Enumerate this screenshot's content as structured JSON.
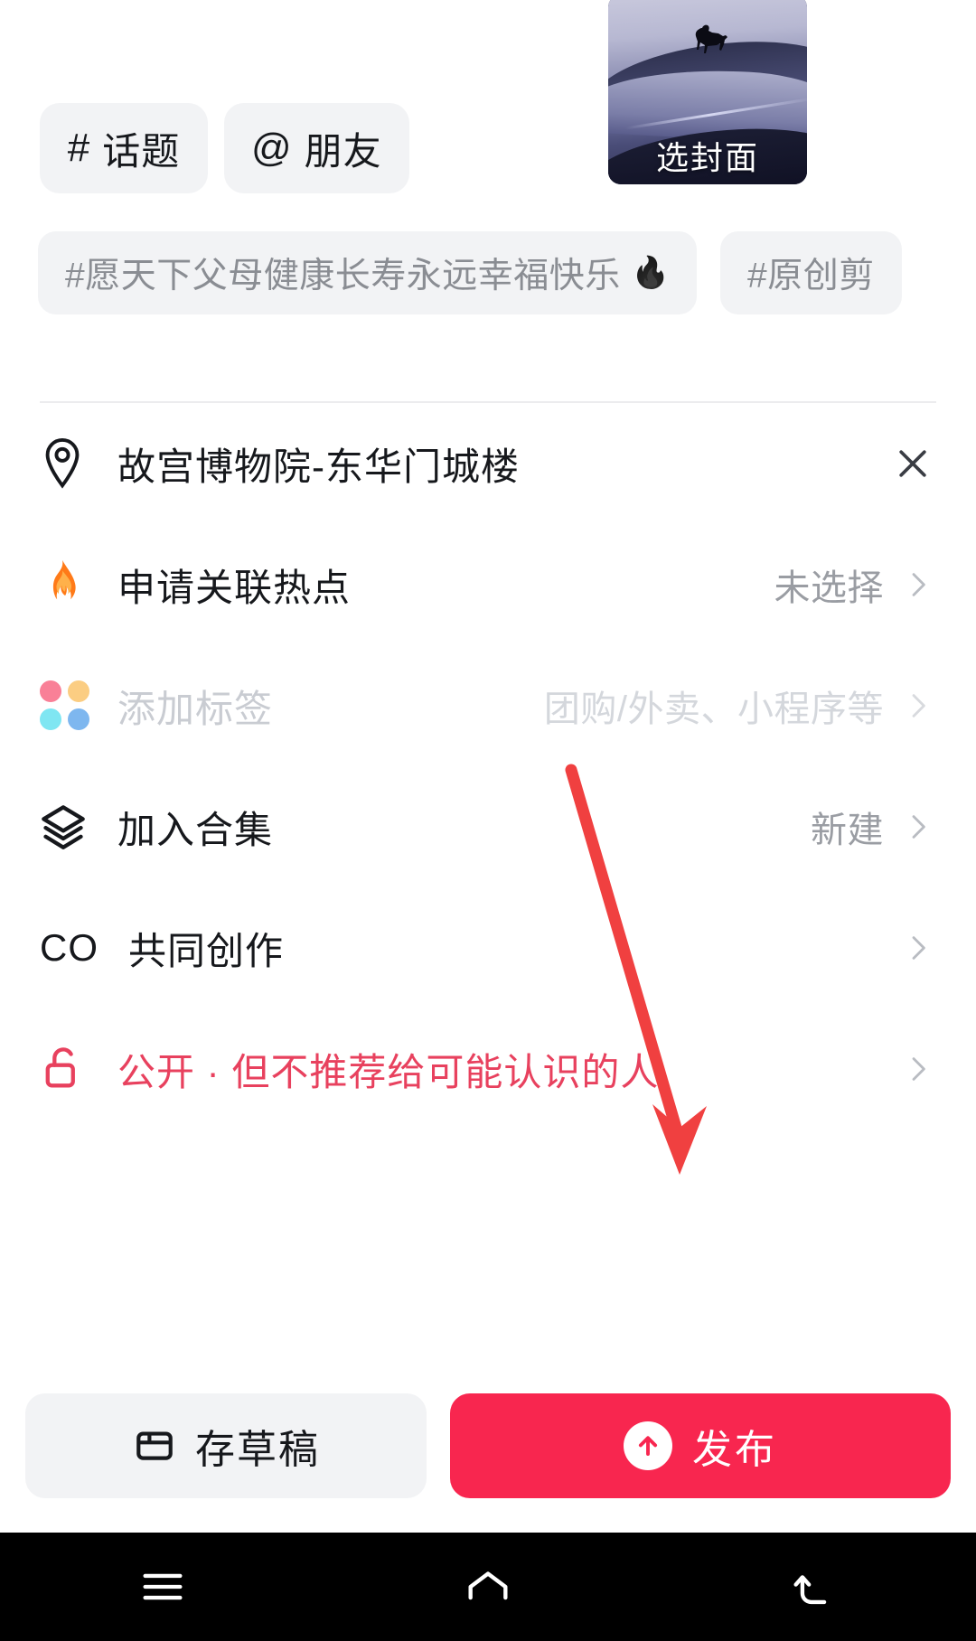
{
  "app": {
    "screen_title": "抖音发布页",
    "accent_color": "#f8264f",
    "privacy_color": "#e8415e",
    "chip_bg": "#f2f3f5"
  },
  "chips": [
    {
      "glyph": "#",
      "label": "话题",
      "icon": "hash-icon"
    },
    {
      "glyph": "@",
      "label": "朋友",
      "icon": "at-icon"
    }
  ],
  "cover": {
    "label": "选封面",
    "icon": "cover-thumbnail",
    "alt": "雪山骑马剪影封面图"
  },
  "tag_suggestions": [
    {
      "text": "#愿天下父母健康长寿永远幸福快乐",
      "fire": "🔥",
      "has_fire": true
    },
    {
      "text": "#原创剪",
      "fire": "",
      "has_fire": false
    }
  ],
  "rows": [
    {
      "key": "location",
      "icon": "location-pin-icon",
      "label": "故宫博物院-东华门城楼",
      "label_style": "normal",
      "value": "",
      "value_style": "normal",
      "trailing": "close",
      "trailing_icon": "close-icon"
    },
    {
      "key": "hotspot",
      "icon": "flame-icon",
      "label": "申请关联热点",
      "label_style": "normal",
      "value": "未选择",
      "value_style": "normal",
      "trailing": "chevron",
      "trailing_icon": "chevron-right-icon"
    },
    {
      "key": "add_tag",
      "icon": "four-dots-icon",
      "label": "添加标签",
      "label_style": "muted",
      "value": "团购/外卖、小程序等",
      "value_style": "faint",
      "trailing": "chevron",
      "trailing_icon": "chevron-right-icon"
    },
    {
      "key": "collection",
      "icon": "layers-icon",
      "label": "加入合集",
      "label_style": "normal",
      "value": "新建",
      "value_style": "normal",
      "trailing": "chevron",
      "trailing_icon": "chevron-right-icon"
    },
    {
      "key": "co_creation",
      "icon": "co-icon",
      "label": "共同创作",
      "label_style": "normal",
      "value": "",
      "value_style": "normal",
      "trailing": "chevron",
      "trailing_icon": "chevron-right-icon"
    },
    {
      "key": "privacy",
      "icon": "unlock-icon",
      "label": "公开 · 但不推荐给可能认识的人",
      "label_style": "accent",
      "value": "",
      "value_style": "normal",
      "trailing": "chevron",
      "trailing_icon": "chevron-right-icon"
    }
  ],
  "tag_dots": [
    "#f98097",
    "#fbcd82",
    "#7fe6f2",
    "#7eb7ef"
  ],
  "actions": {
    "draft_label": "存草稿",
    "draft_icon": "draft-box-icon",
    "publish_label": "发布",
    "publish_icon": "arrow-up-circle-icon"
  },
  "annotation": {
    "type": "red-arrow",
    "points_to": "发布",
    "color": "#f04040"
  },
  "navbar": {
    "items": [
      {
        "key": "recents",
        "icon": "menu-icon"
      },
      {
        "key": "home",
        "icon": "home-icon"
      },
      {
        "key": "back",
        "icon": "back-icon"
      }
    ]
  }
}
